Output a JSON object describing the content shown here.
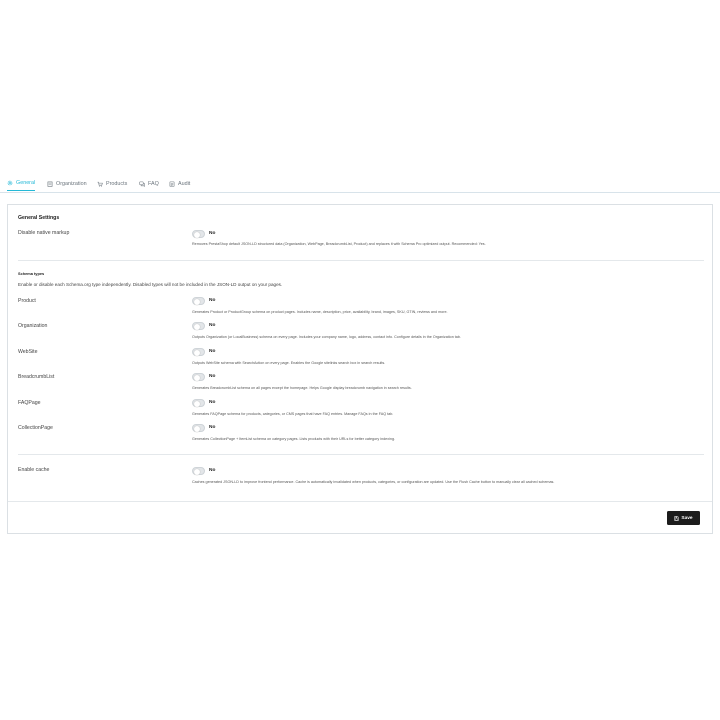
{
  "tabs": [
    {
      "label": "General",
      "icon": "gear-icon",
      "active": true
    },
    {
      "label": "Organization",
      "icon": "building-icon",
      "active": false
    },
    {
      "label": "Products",
      "icon": "cart-icon",
      "active": false
    },
    {
      "label": "FAQ",
      "icon": "chat-icon",
      "active": false
    },
    {
      "label": "Audit",
      "icon": "clipboard-icon",
      "active": false
    }
  ],
  "panel": {
    "title": "General Settings",
    "disable_native": {
      "label": "Disable native markup",
      "value": "No",
      "help": "Removes PrestaShop default JSON-LD structured data (Organization, WebPage, BreadcrumbList, Product) and replaces it with Schema Pro optimized output. Recommended: Yes."
    },
    "schema_types": {
      "title": "Schema types",
      "description": "Enable or disable each Schema.org type independently. Disabled types will not be included in the JSON-LD output on your pages.",
      "items": [
        {
          "label": "Product",
          "value": "No",
          "help": "Generates Product or ProductGroup schema on product pages. Includes name, description, price, availability, brand, images, SKU, GTIN, reviews and more."
        },
        {
          "label": "Organization",
          "value": "No",
          "help": "Outputs Organization (or LocalBusiness) schema on every page. Includes your company name, logo, address, contact info. Configure details in the Organization tab."
        },
        {
          "label": "WebSite",
          "value": "No",
          "help": "Outputs WebSite schema with SearchAction on every page. Enables the Google sitelinks search box in search results."
        },
        {
          "label": "BreadcrumbList",
          "value": "No",
          "help": "Generates BreadcrumbList schema on all pages except the homepage. Helps Google display breadcrumb navigation in search results."
        },
        {
          "label": "FAQPage",
          "value": "No",
          "help": "Generates FAQPage schema for products, categories, or CMS pages that have FAQ entries. Manage FAQs in the FAQ tab."
        },
        {
          "label": "CollectionPage",
          "value": "No",
          "help": "Generates CollectionPage + ItemList schema on category pages. Lists products with their URLs for better category indexing."
        }
      ]
    },
    "enable_cache": {
      "label": "Enable cache",
      "value": "No",
      "help": "Caches generated JSON-LD to improve frontend performance. Cache is automatically invalidated when products, categories, or configuration are updated. Use the Flush Cache button to manually clear all cached schemas."
    },
    "save_label": "Save"
  },
  "colors": {
    "accent": "#25b9d7",
    "save_bg": "#1c1c1c"
  }
}
